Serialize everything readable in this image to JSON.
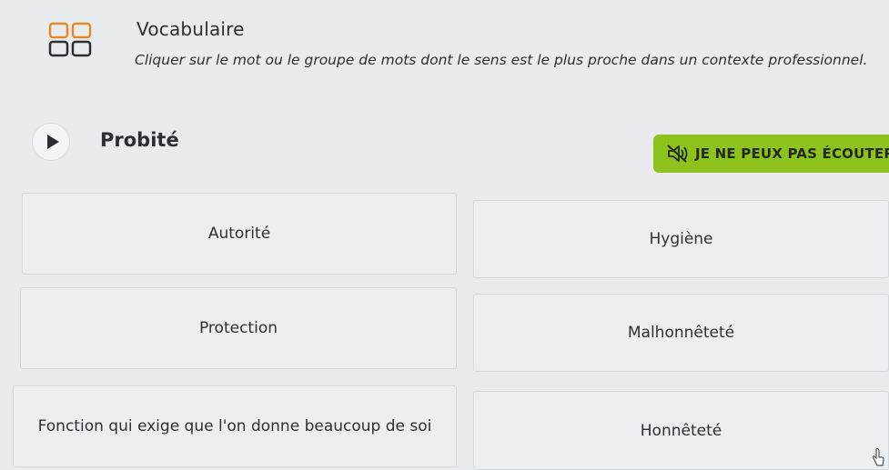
{
  "header": {
    "title": "Vocabulaire",
    "instructions": "Cliquer sur le mot ou le groupe de mots dont le sens est le plus proche dans un contexte professionnel."
  },
  "question": {
    "word": "Probité",
    "play_icon": "play-icon",
    "cannot_listen_label": "JE NE PEUX PAS ÉCOUTER",
    "cannot_listen_icon": "speaker-muted-icon"
  },
  "choices": [
    {
      "label": "Autorité"
    },
    {
      "label": "Hygiène"
    },
    {
      "label": "Protection"
    },
    {
      "label": "Malhonnêteté"
    },
    {
      "label": "Fonction qui exige que l'on donne beaucoup de soi"
    },
    {
      "label": "Honnêteté"
    }
  ],
  "colors": {
    "background": "#e9ecee",
    "accent": "#8ec21c",
    "border": "#d3d8dc"
  }
}
